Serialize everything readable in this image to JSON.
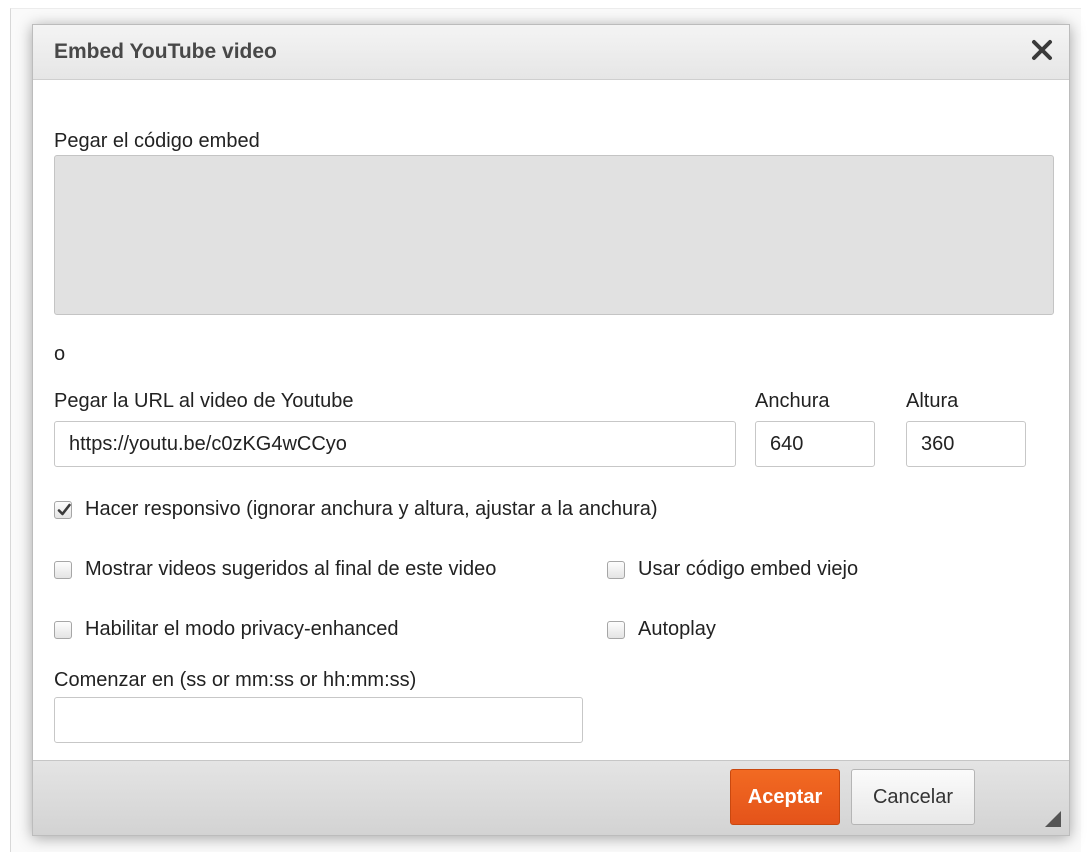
{
  "dialog": {
    "title": "Embed YouTube video",
    "close_icon": "close-icon"
  },
  "embed": {
    "label": "Pegar el código embed",
    "value": ""
  },
  "separator": "o",
  "url": {
    "label": "Pegar la URL al video de Youtube",
    "value": "https://youtu.be/c0zKG4wCCyo"
  },
  "width": {
    "label": "Anchura",
    "value": "640"
  },
  "height": {
    "label": "Altura",
    "value": "360"
  },
  "options": {
    "responsive": {
      "label": "Hacer responsivo (ignorar anchura y altura, ajustar a la anchura)",
      "checked": true
    },
    "suggested": {
      "label": "Mostrar videos sugeridos al final de este video",
      "checked": false
    },
    "old_embed": {
      "label": "Usar código embed viejo",
      "checked": false
    },
    "privacy": {
      "label": "Habilitar el modo privacy-enhanced",
      "checked": false
    },
    "autoplay": {
      "label": "Autoplay",
      "checked": false
    }
  },
  "start": {
    "label": "Comenzar en (ss or mm:ss or hh:mm:ss)",
    "value": ""
  },
  "footer": {
    "ok_label": "Aceptar",
    "cancel_label": "Cancelar"
  },
  "colors": {
    "accent": "#e8591c",
    "embed_bg": "#e1e1e1",
    "titlebar_bg": "#ececec"
  }
}
